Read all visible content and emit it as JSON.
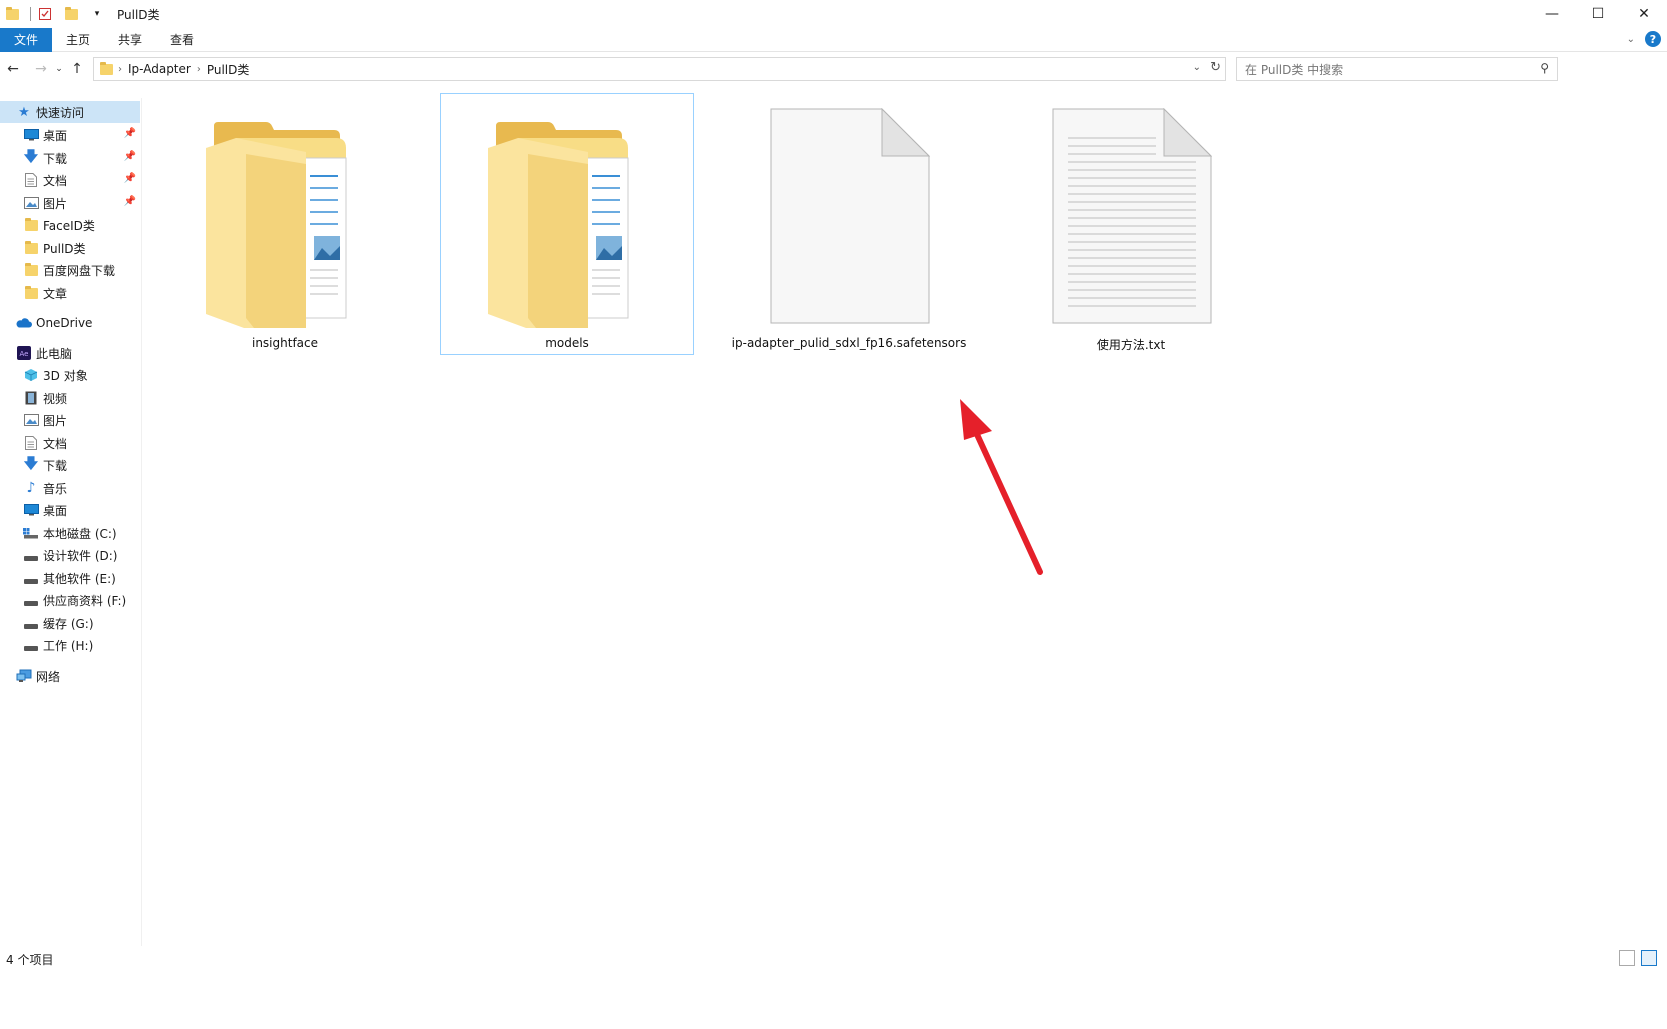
{
  "window": {
    "title": "PullD类"
  },
  "ribbon": {
    "tabs": [
      "文件",
      "主页",
      "共享",
      "查看"
    ]
  },
  "address": {
    "crumbs": [
      "Ip-Adapter",
      "PullD类"
    ]
  },
  "search": {
    "placeholder": "在 PullD类 中搜索"
  },
  "sidebar": {
    "quick_access": "快速访问",
    "quick_items": [
      "桌面",
      "下载",
      "文档",
      "图片",
      "FaceID类",
      "PullD类",
      "百度网盘下载",
      "文章"
    ],
    "onedrive": "OneDrive",
    "this_pc": "此电脑",
    "pc_items": [
      "3D 对象",
      "视频",
      "图片",
      "文档",
      "下载",
      "音乐",
      "桌面",
      "本地磁盘 (C:)",
      "设计软件 (D:)",
      "其他软件 (E:)",
      "供应商资料 (F:)",
      "缓存 (G:)",
      "工作 (H:)"
    ],
    "network": "网络"
  },
  "files": [
    {
      "name": "insightface",
      "kind": "folder"
    },
    {
      "name": "models",
      "kind": "folder",
      "selected": true
    },
    {
      "name": "ip-adapter_pulid_sdxl_fp16.safetensors",
      "kind": "blank-file"
    },
    {
      "name": "使用方法.txt",
      "kind": "text-file"
    }
  ],
  "status": {
    "count": "4 个项目"
  },
  "colors": {
    "accent": "#1979ca",
    "folder": "#f6d36b",
    "selection": "#cce4f7",
    "arrow": "#e5202a"
  }
}
